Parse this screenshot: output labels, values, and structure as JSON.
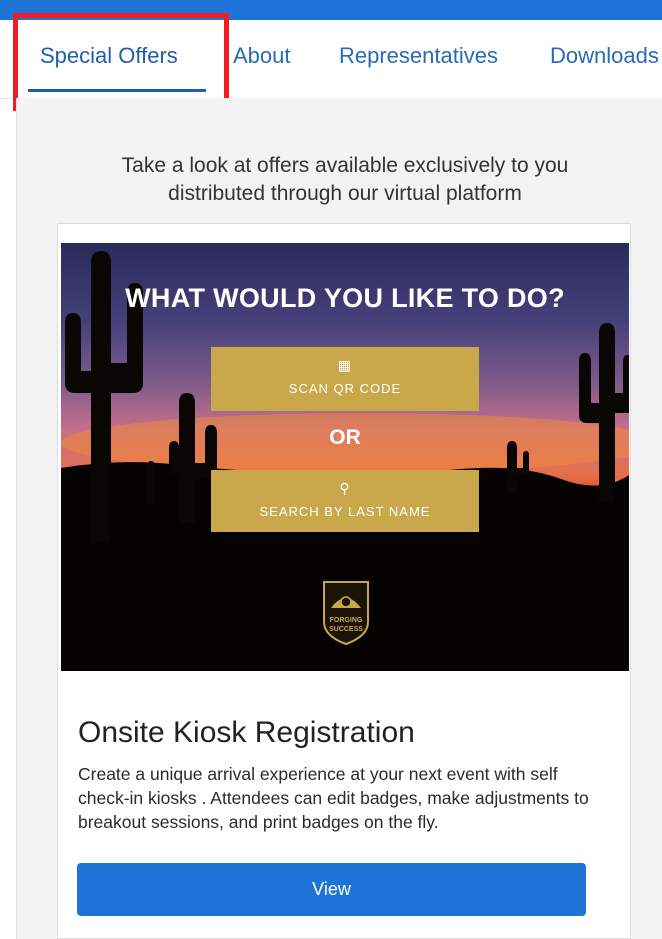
{
  "tabs": [
    {
      "label": "Special Offers",
      "active": true
    },
    {
      "label": "About"
    },
    {
      "label": "Representatives"
    },
    {
      "label": "Downloads"
    }
  ],
  "intro": {
    "line1": "Take a look at offers available exclusively to you",
    "line2": "distributed through our virtual platform"
  },
  "hero": {
    "heading": "WHAT WOULD YOU LIKE TO DO?",
    "scan_label": "SCAN QR CODE",
    "scan_icon": "qr-code-icon",
    "or_label": "OR",
    "search_label": "SEARCH BY LAST NAME",
    "search_icon": "search-icon",
    "logo_text_1": "FORGING",
    "logo_text_2": "SUCCESS"
  },
  "card": {
    "title": "Onsite Kiosk Registration",
    "description": "Create a unique arrival experience at your next event with self check-in kiosks . Attendees can edit badges, make adjustments to breakout sessions, and print badges on the fly.",
    "button_label": "View"
  },
  "colors": {
    "accent_blue": "#1e73d6",
    "tab_text": "#2a6bb5",
    "highlight_red": "#ee1c24",
    "gold": "#c9a84c"
  }
}
